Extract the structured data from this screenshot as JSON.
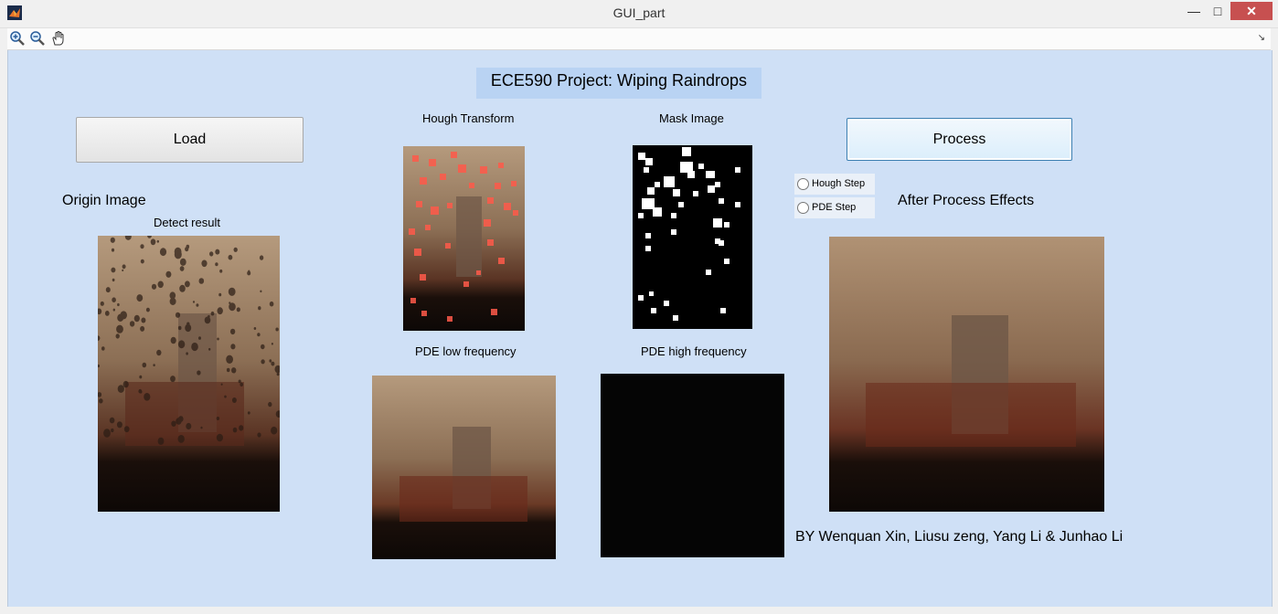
{
  "window": {
    "title": "GUI_part",
    "icon": "matlab-icon",
    "controls": {
      "minimize": "—",
      "maximize": "□",
      "close": "✕"
    }
  },
  "toolbar": {
    "tools": [
      "zoom-in-icon",
      "zoom-out-icon",
      "pan-hand-icon"
    ],
    "overflow_arrow": "↘"
  },
  "colors": {
    "figure_background": "#cfe0f6",
    "title_panel": "#b9d3f3",
    "close_button": "#c75050"
  },
  "project_title": "ECE590 Project: Wiping Raindrops",
  "buttons": {
    "load": "Load",
    "process": "Process"
  },
  "labels": {
    "origin": "Origin Image",
    "detect": "Detect result",
    "hough": "Hough Transform",
    "mask": "Mask Image",
    "pde_low": "PDE low frequency",
    "pde_high": "PDE high frequency",
    "after": "After Process Effects",
    "credits": "BY Wenquan Xin, Liusu zeng, Yang Li & Junhao Li"
  },
  "radios": [
    {
      "label": "Hough Step",
      "checked": false
    },
    {
      "label": "PDE Step",
      "checked": false
    }
  ]
}
